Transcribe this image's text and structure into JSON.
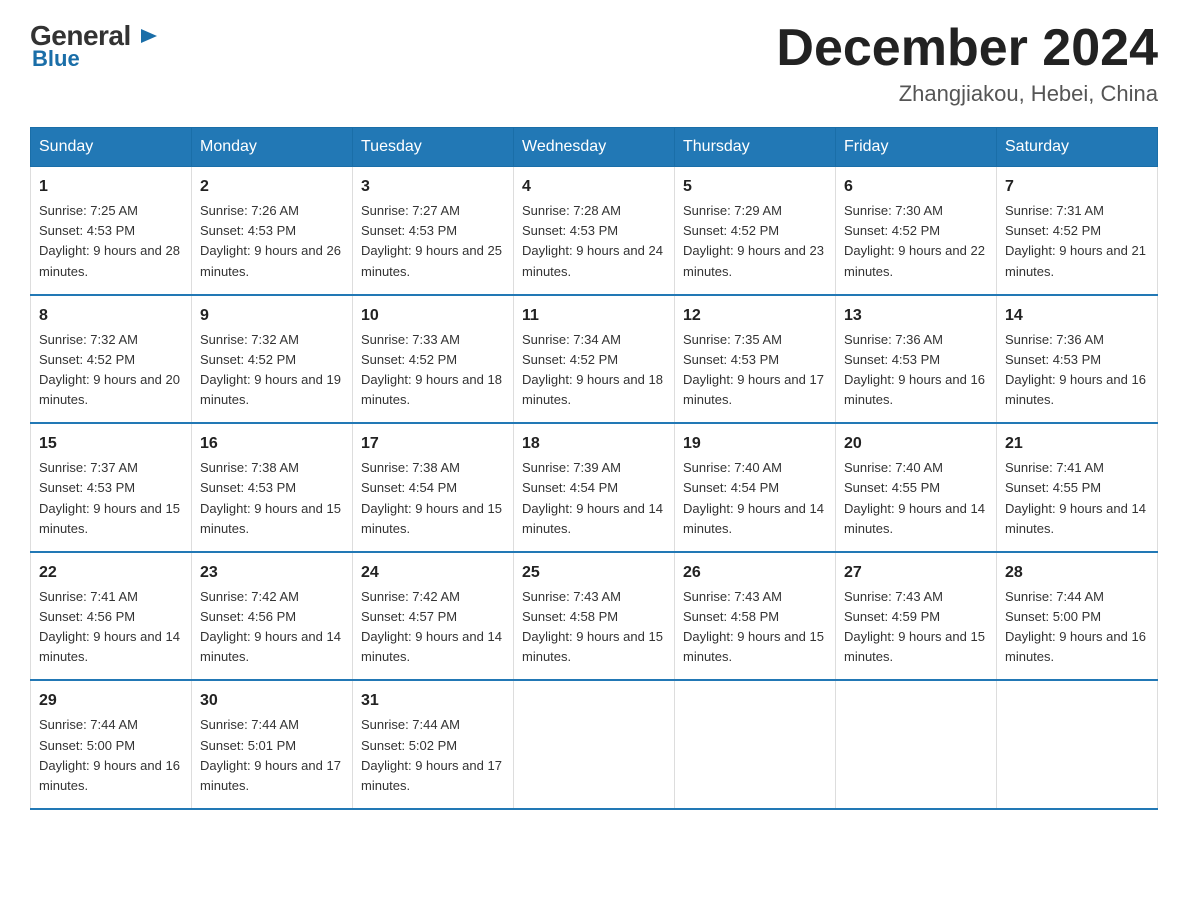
{
  "logo": {
    "general": "General",
    "blue": "Blue",
    "triangle": "▲"
  },
  "title": {
    "month_year": "December 2024",
    "location": "Zhangjiakou, Hebei, China"
  },
  "headers": [
    "Sunday",
    "Monday",
    "Tuesday",
    "Wednesday",
    "Thursday",
    "Friday",
    "Saturday"
  ],
  "weeks": [
    [
      {
        "day": "1",
        "sunrise": "7:25 AM",
        "sunset": "4:53 PM",
        "daylight": "9 hours and 28 minutes."
      },
      {
        "day": "2",
        "sunrise": "7:26 AM",
        "sunset": "4:53 PM",
        "daylight": "9 hours and 26 minutes."
      },
      {
        "day": "3",
        "sunrise": "7:27 AM",
        "sunset": "4:53 PM",
        "daylight": "9 hours and 25 minutes."
      },
      {
        "day": "4",
        "sunrise": "7:28 AM",
        "sunset": "4:53 PM",
        "daylight": "9 hours and 24 minutes."
      },
      {
        "day": "5",
        "sunrise": "7:29 AM",
        "sunset": "4:52 PM",
        "daylight": "9 hours and 23 minutes."
      },
      {
        "day": "6",
        "sunrise": "7:30 AM",
        "sunset": "4:52 PM",
        "daylight": "9 hours and 22 minutes."
      },
      {
        "day": "7",
        "sunrise": "7:31 AM",
        "sunset": "4:52 PM",
        "daylight": "9 hours and 21 minutes."
      }
    ],
    [
      {
        "day": "8",
        "sunrise": "7:32 AM",
        "sunset": "4:52 PM",
        "daylight": "9 hours and 20 minutes."
      },
      {
        "day": "9",
        "sunrise": "7:32 AM",
        "sunset": "4:52 PM",
        "daylight": "9 hours and 19 minutes."
      },
      {
        "day": "10",
        "sunrise": "7:33 AM",
        "sunset": "4:52 PM",
        "daylight": "9 hours and 18 minutes."
      },
      {
        "day": "11",
        "sunrise": "7:34 AM",
        "sunset": "4:52 PM",
        "daylight": "9 hours and 18 minutes."
      },
      {
        "day": "12",
        "sunrise": "7:35 AM",
        "sunset": "4:53 PM",
        "daylight": "9 hours and 17 minutes."
      },
      {
        "day": "13",
        "sunrise": "7:36 AM",
        "sunset": "4:53 PM",
        "daylight": "9 hours and 16 minutes."
      },
      {
        "day": "14",
        "sunrise": "7:36 AM",
        "sunset": "4:53 PM",
        "daylight": "9 hours and 16 minutes."
      }
    ],
    [
      {
        "day": "15",
        "sunrise": "7:37 AM",
        "sunset": "4:53 PM",
        "daylight": "9 hours and 15 minutes."
      },
      {
        "day": "16",
        "sunrise": "7:38 AM",
        "sunset": "4:53 PM",
        "daylight": "9 hours and 15 minutes."
      },
      {
        "day": "17",
        "sunrise": "7:38 AM",
        "sunset": "4:54 PM",
        "daylight": "9 hours and 15 minutes."
      },
      {
        "day": "18",
        "sunrise": "7:39 AM",
        "sunset": "4:54 PM",
        "daylight": "9 hours and 14 minutes."
      },
      {
        "day": "19",
        "sunrise": "7:40 AM",
        "sunset": "4:54 PM",
        "daylight": "9 hours and 14 minutes."
      },
      {
        "day": "20",
        "sunrise": "7:40 AM",
        "sunset": "4:55 PM",
        "daylight": "9 hours and 14 minutes."
      },
      {
        "day": "21",
        "sunrise": "7:41 AM",
        "sunset": "4:55 PM",
        "daylight": "9 hours and 14 minutes."
      }
    ],
    [
      {
        "day": "22",
        "sunrise": "7:41 AM",
        "sunset": "4:56 PM",
        "daylight": "9 hours and 14 minutes."
      },
      {
        "day": "23",
        "sunrise": "7:42 AM",
        "sunset": "4:56 PM",
        "daylight": "9 hours and 14 minutes."
      },
      {
        "day": "24",
        "sunrise": "7:42 AM",
        "sunset": "4:57 PM",
        "daylight": "9 hours and 14 minutes."
      },
      {
        "day": "25",
        "sunrise": "7:43 AM",
        "sunset": "4:58 PM",
        "daylight": "9 hours and 15 minutes."
      },
      {
        "day": "26",
        "sunrise": "7:43 AM",
        "sunset": "4:58 PM",
        "daylight": "9 hours and 15 minutes."
      },
      {
        "day": "27",
        "sunrise": "7:43 AM",
        "sunset": "4:59 PM",
        "daylight": "9 hours and 15 minutes."
      },
      {
        "day": "28",
        "sunrise": "7:44 AM",
        "sunset": "5:00 PM",
        "daylight": "9 hours and 16 minutes."
      }
    ],
    [
      {
        "day": "29",
        "sunrise": "7:44 AM",
        "sunset": "5:00 PM",
        "daylight": "9 hours and 16 minutes."
      },
      {
        "day": "30",
        "sunrise": "7:44 AM",
        "sunset": "5:01 PM",
        "daylight": "9 hours and 17 minutes."
      },
      {
        "day": "31",
        "sunrise": "7:44 AM",
        "sunset": "5:02 PM",
        "daylight": "9 hours and 17 minutes."
      },
      null,
      null,
      null,
      null
    ]
  ]
}
